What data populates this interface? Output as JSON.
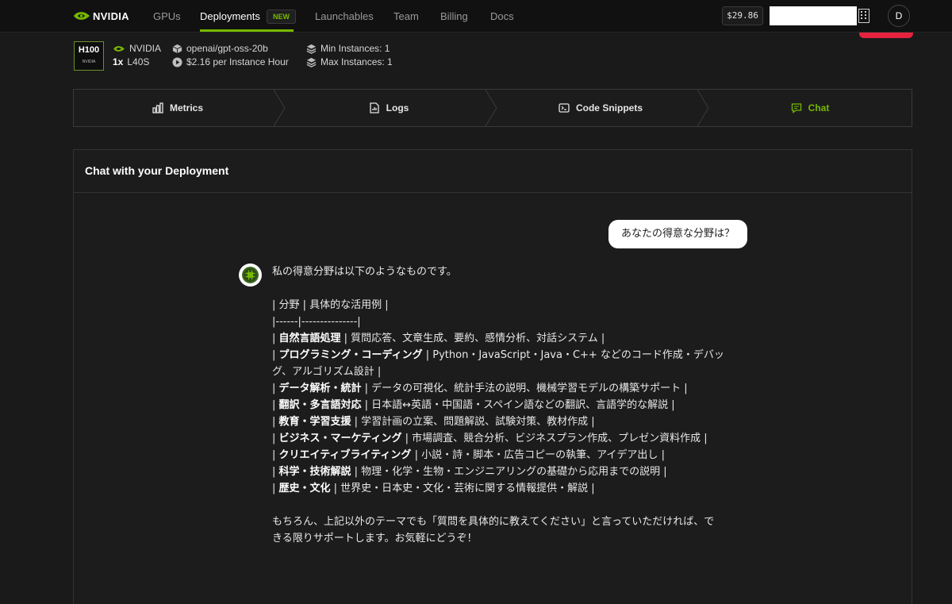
{
  "nav": {
    "logo": "NVIDIA",
    "items": [
      "GPUs",
      "Deployments",
      "Launchables",
      "Team",
      "Billing",
      "Docs"
    ],
    "new_badge": "NEW",
    "balance": "$29.86",
    "avatar_initial": "D"
  },
  "deployment": {
    "gpu_chip": "H100",
    "gpu_chip_sub": "NVIDIA",
    "provider": "NVIDIA",
    "gpu_count": "1x",
    "gpu_type": "L40S",
    "model": "openai/gpt-oss-20b",
    "price": "$2.16 per Instance Hour",
    "min_instances": "Min Instances: 1",
    "max_instances": "Max Instances: 1"
  },
  "tabs": [
    {
      "label": "Metrics",
      "icon": "bar-chart-icon"
    },
    {
      "label": "Logs",
      "icon": "file-chart-icon"
    },
    {
      "label": "Code Snippets",
      "icon": "terminal-icon"
    },
    {
      "label": "Chat",
      "icon": "chat-icon",
      "active": true
    }
  ],
  "chat": {
    "title": "Chat with your Deployment",
    "user_message": "あなたの得意な分野は？",
    "assistant_lines": [
      {
        "text": "私の得意分野は以下のようなものです。"
      },
      {
        "text": ""
      },
      {
        "text": "| 分野 | 具体的な活用例 |"
      },
      {
        "text": "|------|---------------|"
      },
      {
        "bold": "自然言語処理",
        "rest": " | 質問応答、文章生成、要約、感情分析、対話システム |"
      },
      {
        "bold": "プログラミング・コーディング",
        "rest": " | Python・JavaScript・Java・C++ などのコード作成・デバッ"
      },
      {
        "text": "グ、アルゴリズム設計 |"
      },
      {
        "bold": "データ解析・統計",
        "rest": " | データの可視化、統計手法の説明、機械学習モデルの構築サポート |"
      },
      {
        "bold": "翻訳・多言語対応",
        "rest": " | 日本語↔英語・中国語・スペイン語などの翻訳、言語学的な解説 |"
      },
      {
        "bold": "教育・学習支援",
        "rest": " | 学習計画の立案、問題解説、試験対策、教材作成 |"
      },
      {
        "bold": "ビジネス・マーケティング",
        "rest": " | 市場調査、競合分析、ビジネスプラン作成、プレゼン資料作成 |"
      },
      {
        "bold": "クリエイティブライティング",
        "rest": " | 小説・詩・脚本・広告コピーの執筆、アイデア出し |"
      },
      {
        "bold": "科学・技術解説",
        "rest": " | 物理・化学・生物・エンジニアリングの基礎から応用までの説明 |"
      },
      {
        "bold": "歴史・文化",
        "rest": " | 世界史・日本史・文化・芸術に関する情報提供・解説 |"
      },
      {
        "text": ""
      },
      {
        "text": "もちろん、上記以外のテーマでも「質問を具体的に教えてください」と言っていただければ、で"
      },
      {
        "text": "きる限りサポートします。お気軽にどうぞ！"
      }
    ]
  },
  "colors": {
    "accent": "#76b900",
    "background": "#1a1a1a",
    "danger": "#e5233f"
  }
}
